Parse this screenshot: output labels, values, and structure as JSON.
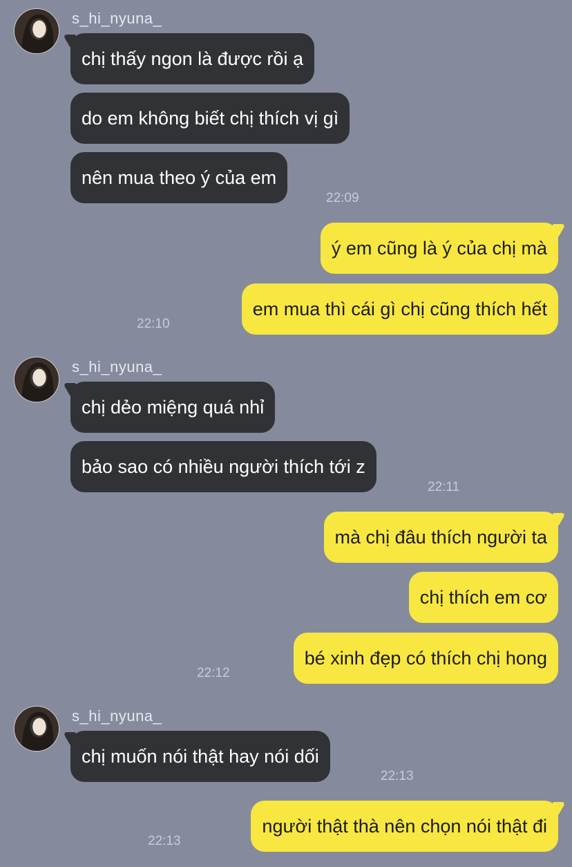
{
  "sender_name": "s_hi_nyuna_",
  "groups": [
    {
      "side": "in",
      "messages": [
        "chị thấy ngon là được rồi ạ",
        "do em không biết chị thích vị gì",
        "nên mua theo ý của em"
      ],
      "time": "22:09"
    },
    {
      "side": "out",
      "messages": [
        "ý em cũng là ý của chị mà",
        "em mua thì cái gì chị cũng thích hết"
      ],
      "time": "22:10"
    },
    {
      "side": "in",
      "messages": [
        "chị dẻo miệng quá nhỉ",
        "bảo sao có nhiều người thích tới z"
      ],
      "time": "22:11"
    },
    {
      "side": "out",
      "messages": [
        "mà chị đâu thích người ta",
        "chị thích em cơ",
        "bé xinh đẹp có thích chị hong"
      ],
      "time": "22:12"
    },
    {
      "side": "in",
      "messages": [
        "chị muốn nói thật hay nói dối"
      ],
      "time": "22:13"
    },
    {
      "side": "out",
      "messages": [
        "người thật thà nên chọn nói thật đi"
      ],
      "time": "22:13"
    }
  ]
}
